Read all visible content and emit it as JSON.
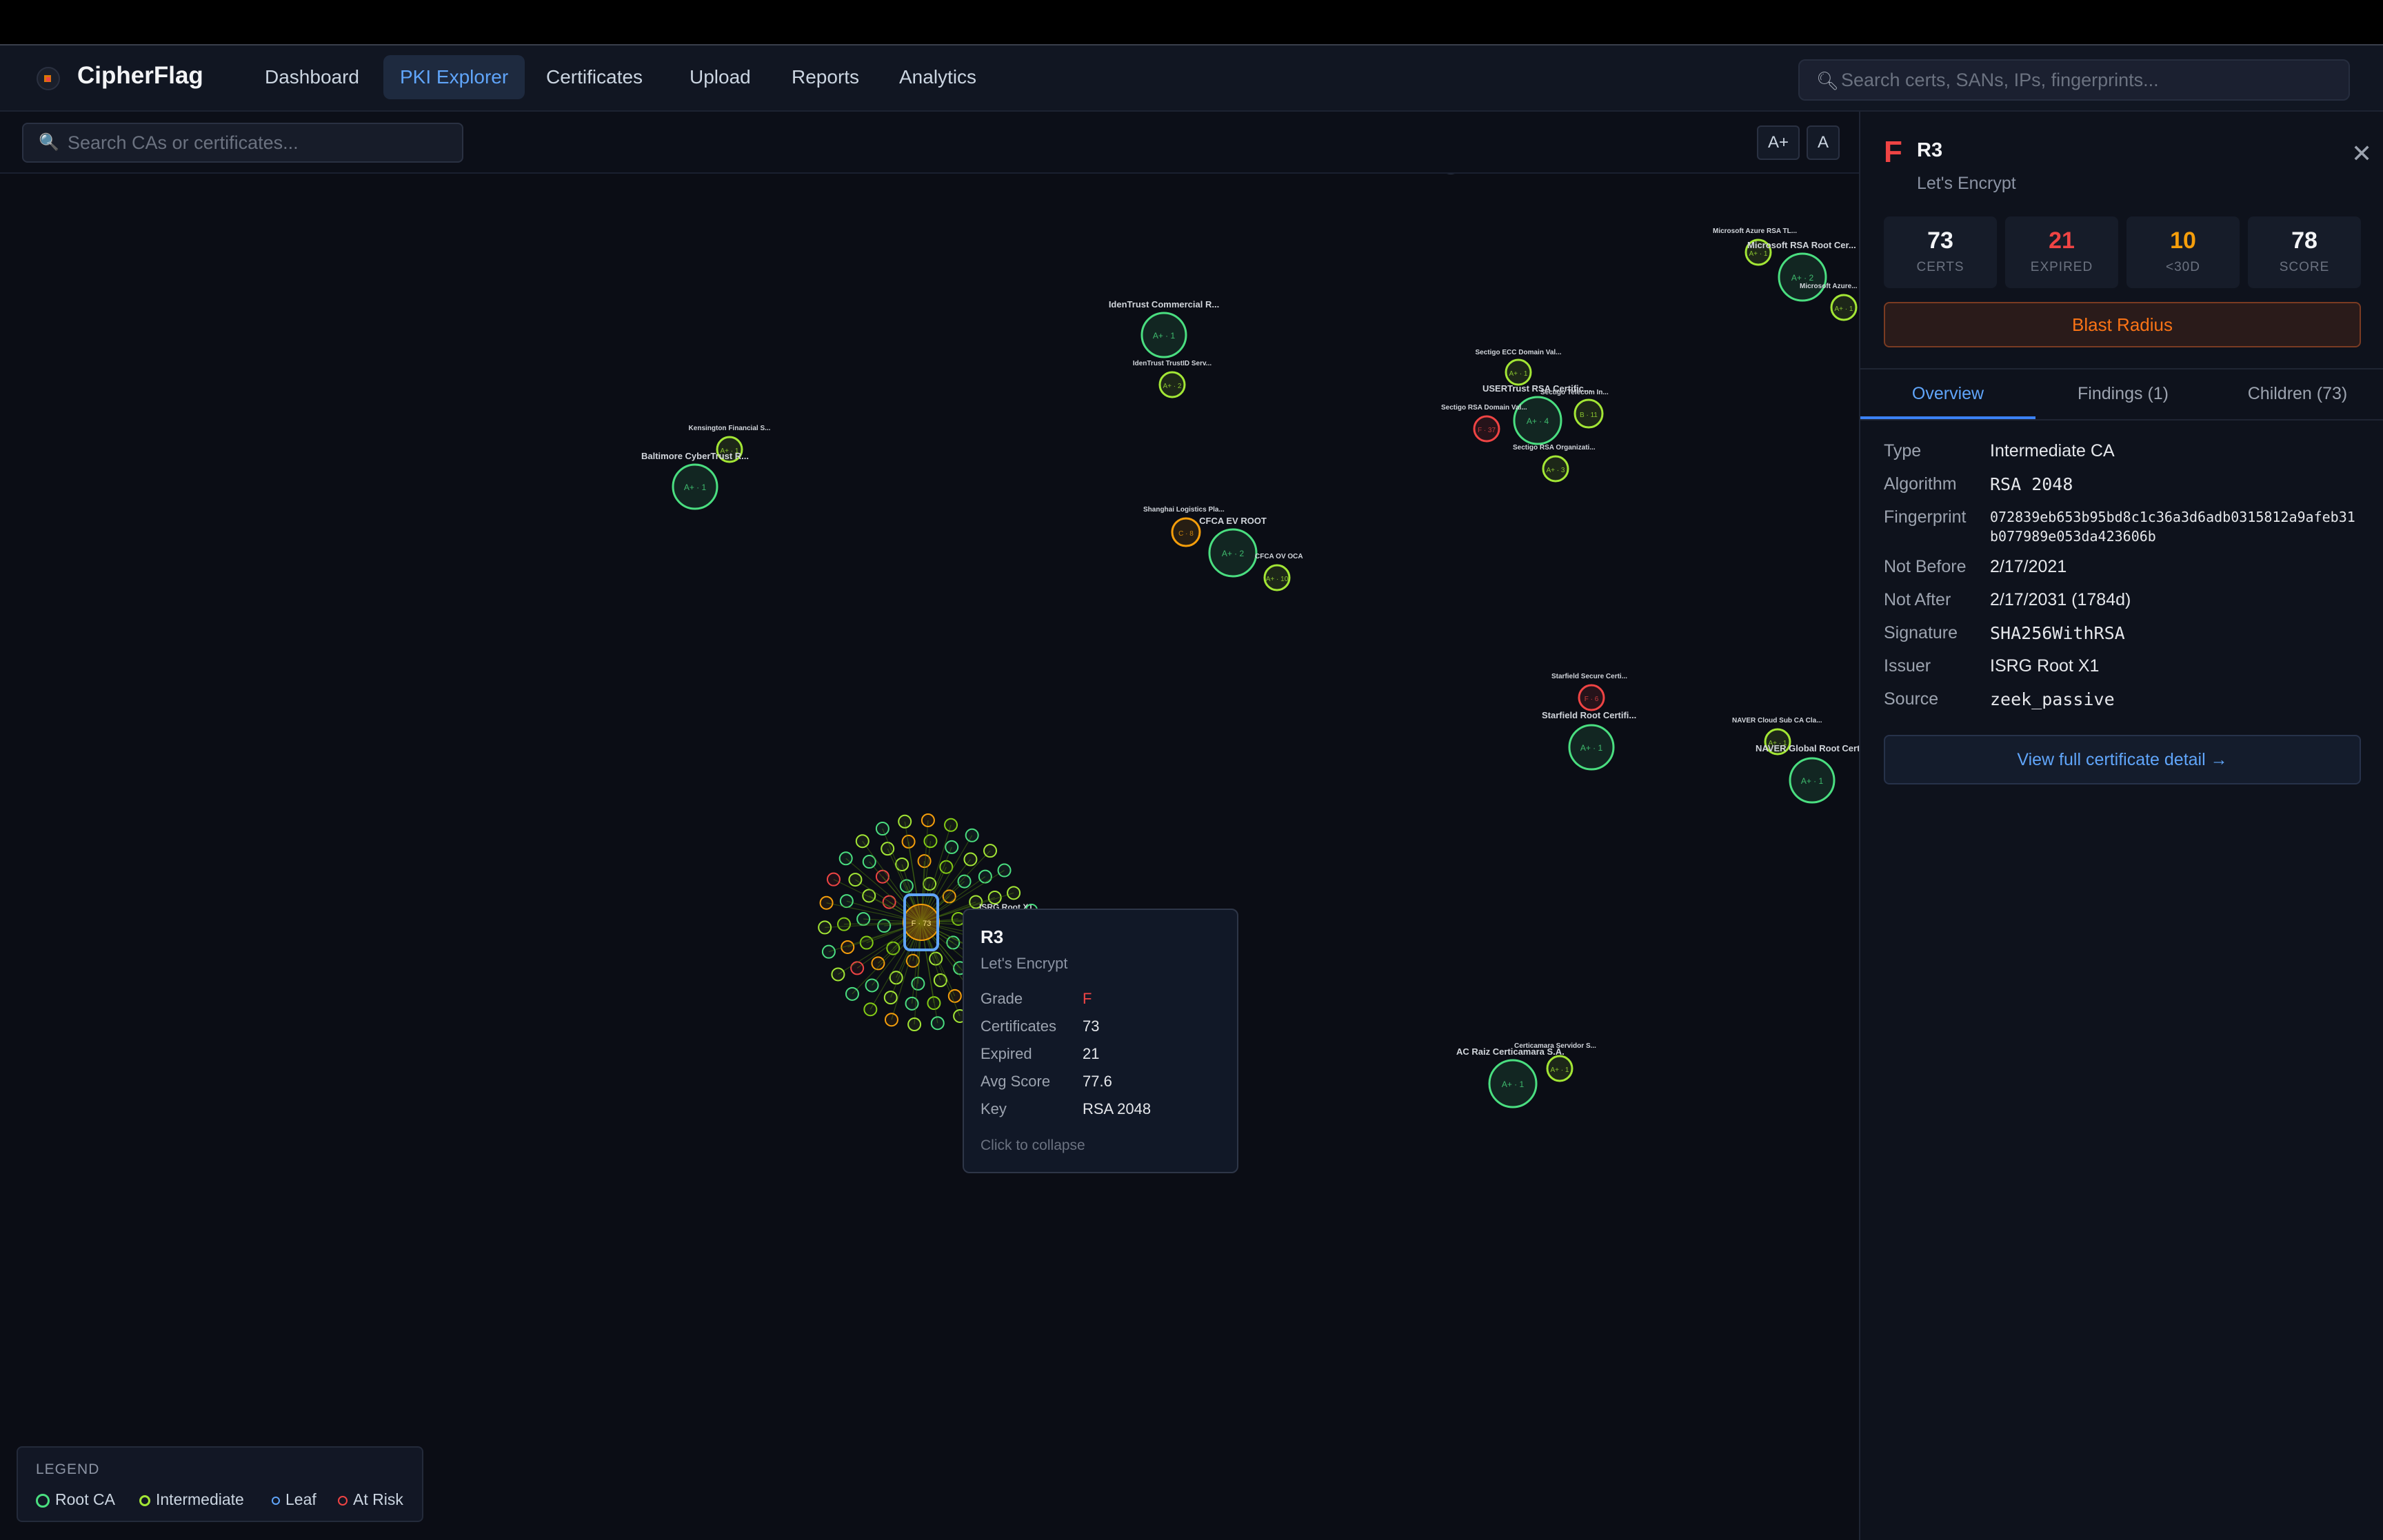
{
  "brand": "CipherFlag",
  "nav": [
    {
      "label": "Dashboard",
      "active": false
    },
    {
      "label": "PKI Explorer",
      "active": true
    },
    {
      "label": "Certificates",
      "active": false
    },
    {
      "label": "Upload",
      "active": false
    },
    {
      "label": "Reports",
      "active": false
    },
    {
      "label": "Analytics",
      "active": false
    }
  ],
  "global_search": {
    "placeholder": "Search certs, SANs, IPs, fingerprints..."
  },
  "ca_search": {
    "placeholder": "Search CAs or certificates..."
  },
  "font_buttons": [
    "A+",
    "A"
  ],
  "colors": {
    "root": "#4ade80",
    "intermediate": "#a3e635",
    "leaf": "#60a5fa",
    "at_risk": "#ef4444",
    "warning": "#f59e0b",
    "accent": "#60a5fa"
  },
  "graph": {
    "nodes": [
      {
        "label": "IdenTrust Commercial R...",
        "badge": "A+ · 1",
        "kind": "root"
      },
      {
        "label": "IdenTrust TrustID Serv...",
        "badge": "A+ · 2",
        "kind": "inter"
      },
      {
        "label": "Kensington Financial S...",
        "badge": "A+ · 1",
        "kind": "inter"
      },
      {
        "label": "Baltimore CyberTrust R...",
        "badge": "A+ · 1",
        "kind": "root"
      },
      {
        "label": "Shanghai Logistics Pla...",
        "badge": "C · 8",
        "kind": "warn"
      },
      {
        "label": "CFCA EV ROOT",
        "badge": "A+ · 2",
        "kind": "root"
      },
      {
        "label": "CFCA OV OCA",
        "badge": "A+ · 10",
        "kind": "inter"
      },
      {
        "label": "Sectigo ECC Domain Val...",
        "badge": "A+ · 1",
        "kind": "inter"
      },
      {
        "label": "USERTrust RSA Certific...",
        "badge": "A+ · 4",
        "kind": "root"
      },
      {
        "label": "Sectigo RSA Domain Val...",
        "badge": "F · 37",
        "kind": "risk"
      },
      {
        "label": "Sectigo Telecom In...",
        "badge": "B · 11",
        "kind": "inter"
      },
      {
        "label": "Sectigo RSA Organizati...",
        "badge": "A+ · 3",
        "kind": "inter"
      },
      {
        "label": "Microsoft Azure RSA TL...",
        "badge": "A+ · 1",
        "kind": "inter"
      },
      {
        "label": "Microsoft RSA Root Cer...",
        "badge": "A+ · 2",
        "kind": "root"
      },
      {
        "label": "Microsoft Azure...",
        "badge": "A+ · 1",
        "kind": "inter"
      },
      {
        "label": "Starfield Secure Certi...",
        "badge": "F · 6",
        "kind": "risk"
      },
      {
        "label": "Starfield Root Certifi...",
        "badge": "A+ · 1",
        "kind": "root"
      },
      {
        "label": "NAVER Cloud Sub CA Cla...",
        "badge": "A+ · 1",
        "kind": "inter"
      },
      {
        "label": "NAVER Global Root Cert...",
        "badge": "A+ · 1",
        "kind": "root"
      },
      {
        "label": "Certicamara Servidor S...",
        "badge": "A+ · 1",
        "kind": "inter"
      },
      {
        "label": "AC Raiz Certicamara S.A.",
        "badge": "A+ · 1",
        "kind": "root"
      },
      {
        "label": "ISRG Root X1",
        "badge": "",
        "kind": "root"
      }
    ],
    "selected_badge": "F · 73"
  },
  "tooltip": {
    "title": "R3",
    "subtitle": "Let's Encrypt",
    "rows": [
      {
        "key": "Grade",
        "value": "F"
      },
      {
        "key": "Certificates",
        "value": "73"
      },
      {
        "key": "Expired",
        "value": "21"
      },
      {
        "key": "Avg Score",
        "value": "77.6"
      },
      {
        "key": "Key",
        "value": "RSA 2048"
      }
    ],
    "footer": "Click to collapse"
  },
  "legend": {
    "title": "LEGEND",
    "items": [
      "Root CA",
      "Intermediate",
      "Leaf",
      "At Risk"
    ]
  },
  "panel": {
    "grade": "F",
    "title": "R3",
    "subtitle": "Let's Encrypt",
    "close": "✕",
    "stats": [
      {
        "value": "73",
        "label": "CERTS",
        "color": "#f3f4f6"
      },
      {
        "value": "21",
        "label": "EXPIRED",
        "color": "#ef4444"
      },
      {
        "value": "10",
        "label": "<30D",
        "color": "#f59e0b"
      },
      {
        "value": "78",
        "label": "SCORE",
        "color": "#f3f4f6"
      }
    ],
    "blast_radius": "Blast Radius",
    "tabs": [
      "Overview",
      "Findings (1)",
      "Children (73)"
    ],
    "details": [
      {
        "key": "Type",
        "value": "Intermediate CA"
      },
      {
        "key": "Algorithm",
        "value": "RSA 2048"
      },
      {
        "key": "Fingerprint",
        "value": "072839eb653b95bd8c1c36a3d6adb0315812a9afeb31b077989e053da423606b"
      },
      {
        "key": "Not Before",
        "value": "2/17/2021"
      },
      {
        "key": "Not After",
        "value": "2/17/2031 (1784d)"
      },
      {
        "key": "Signature",
        "value": "SHA256WithRSA"
      },
      {
        "key": "Issuer",
        "value": "ISRG Root X1"
      },
      {
        "key": "Source",
        "value": "zeek_passive"
      }
    ],
    "detail_link": "View full certificate detail →"
  }
}
